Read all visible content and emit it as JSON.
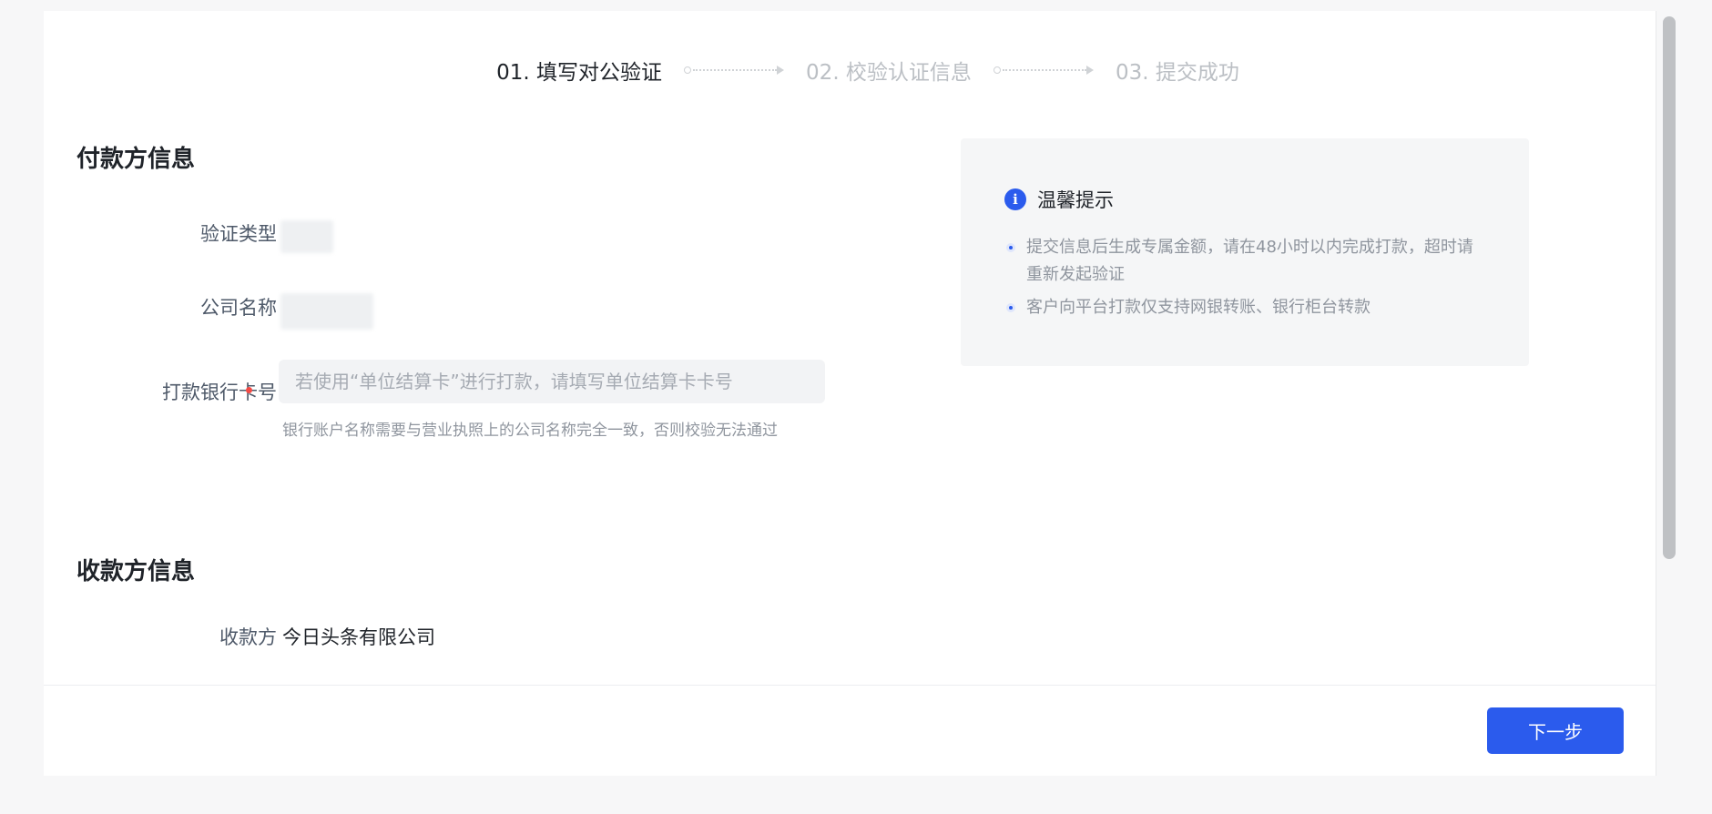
{
  "steps": [
    {
      "label": "01. 填写对公验证",
      "state": "active"
    },
    {
      "label": "02. 校验认证信息",
      "state": "inactive"
    },
    {
      "label": "03. 提交成功",
      "state": "inactive"
    }
  ],
  "payer": {
    "title": "付款方信息",
    "verify_type_label": "验证类型",
    "company_name_label": "公司名称",
    "bank_card_label": "打款银行卡号",
    "bank_card_placeholder": "若使用“单位结算卡”进行打款，请填写单位结算卡卡号",
    "bank_card_value": "",
    "bank_card_hint": "银行账户名称需要与营业执照上的公司名称完全一致，否则校验无法通过"
  },
  "payee": {
    "title": "收款方信息",
    "payee_label": "收款方",
    "payee_value": "今日头条有限公司"
  },
  "tips": {
    "title": "温馨提示",
    "icon": "info-icon",
    "items": [
      "提交信息后生成专属金额，请在48小时以内完成打款，超时请重新发起验证",
      "客户向平台打款仅支持网银转账、银行柜台转款"
    ]
  },
  "footer": {
    "next_label": "下一步"
  },
  "colors": {
    "accent": "#2b5bed",
    "required": "#f54a45"
  }
}
